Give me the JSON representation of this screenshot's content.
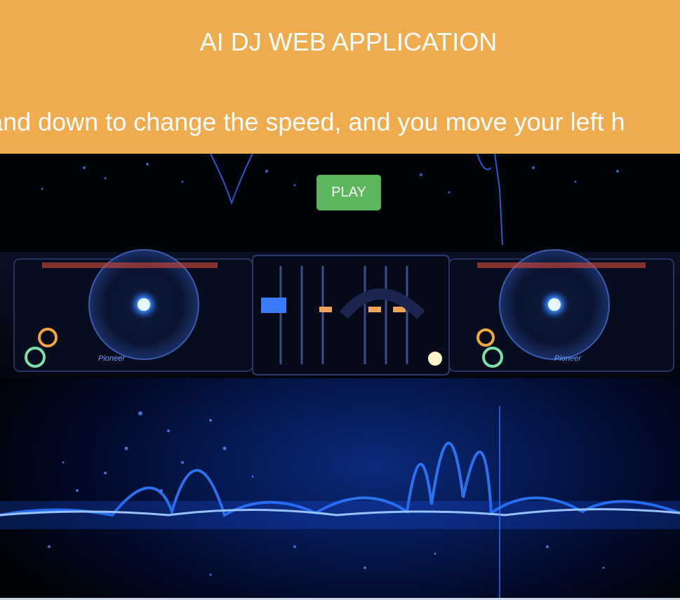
{
  "header": {
    "title": "AI DJ WEB APPLICATION",
    "marquee_text": "d up and down to change the speed, and you move your left h",
    "background_color": "#EEAC4F"
  },
  "controls": {
    "play_label": "PLAY",
    "play_color": "#5CB85C"
  },
  "background": {
    "deck_left_brand": "Pioneer",
    "deck_right_brand": "Pioneer",
    "accent_color": "#1e6fff"
  }
}
